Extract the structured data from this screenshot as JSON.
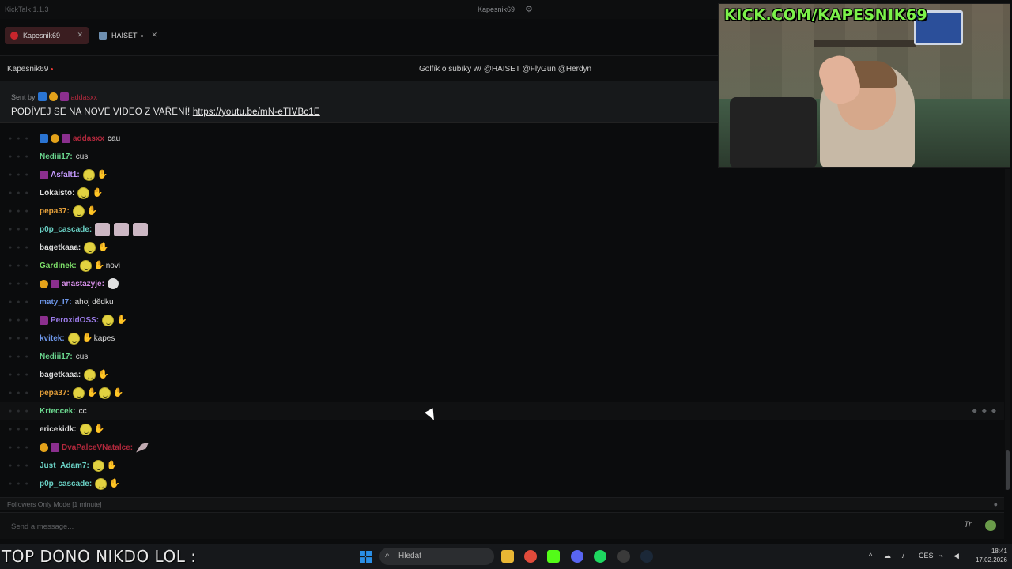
{
  "app": {
    "title": "KickTalk 1.1.3",
    "current_user": "Kapesnik69",
    "settings_icon": "gear-icon"
  },
  "tabs": [
    {
      "label": "Kapesnik69",
      "active": true
    },
    {
      "label": "HAISET",
      "active": false
    }
  ],
  "channel": {
    "name": "Kapesnik69",
    "stream_title": "Golfík o subíky w/ @HAISET @FlyGun @Herdyn"
  },
  "pinned": {
    "sent_by_label": "Sent by",
    "sent_by_user": "addasxx",
    "message": "PODÍVEJ SE NA NOVÉ VIDEO Z VAŘENÍ!",
    "link": "https://youtu.be/mN-eTIVBc1E"
  },
  "messages": [
    {
      "user": "addasxx",
      "color": "#b1283c",
      "text": "cau",
      "emotes": []
    },
    {
      "user": "Nediii17:",
      "color": "#6bd88f",
      "text": "cus",
      "emotes": []
    },
    {
      "user": "Asfalt1:",
      "color": "#c69bff",
      "text": "",
      "emotes": [
        "smile",
        "wave"
      ]
    },
    {
      "user": "Lokaisto:",
      "color": "#dedede",
      "text": "",
      "emotes": [
        "smile",
        "wave"
      ]
    },
    {
      "user": "pepa37:",
      "color": "#e5a03a",
      "text": "",
      "emotes": [
        "smile",
        "wave"
      ]
    },
    {
      "user": "p0p_cascade:",
      "color": "#6ad1c5",
      "text": "",
      "emotes": [
        "cat",
        "cat",
        "cat"
      ]
    },
    {
      "user": "bagetkaaa:",
      "color": "#dedede",
      "text": "",
      "emotes": [
        "smile",
        "wave"
      ]
    },
    {
      "user": "Gardinek:",
      "color": "#7ee06a",
      "text": "novi",
      "emotes": [
        "smile",
        "wave"
      ]
    },
    {
      "user": "anastazyje:",
      "color": "#d68fe8",
      "text": "",
      "emotes": [
        "skull"
      ]
    },
    {
      "user": "maty_I7:",
      "color": "#6d96e8",
      "text": "ahoj dědku",
      "emotes": []
    },
    {
      "user": "PeroxidOSS:",
      "color": "#9b7be8",
      "text": "",
      "emotes": [
        "smile",
        "wave"
      ]
    },
    {
      "user": "kvitek:",
      "color": "#6d96e8",
      "text": "kapes",
      "emotes": [
        "smile",
        "wave"
      ]
    },
    {
      "user": "Nediii17:",
      "color": "#6bd88f",
      "text": "cus",
      "emotes": []
    },
    {
      "user": "bagetkaaa:",
      "color": "#dedede",
      "text": "",
      "emotes": [
        "smile",
        "wave"
      ]
    },
    {
      "user": "pepa37:",
      "color": "#e5a03a",
      "text": "",
      "emotes": [
        "smile",
        "wave",
        "smile",
        "wave"
      ]
    },
    {
      "user": "Krteccek:",
      "color": "#6bd88f",
      "text": "cc",
      "emotes": []
    },
    {
      "user": "ericekidk:",
      "color": "#dedede",
      "text": "",
      "emotes": [
        "smile",
        "wave"
      ]
    },
    {
      "user": "DvaPalceVNatalce:",
      "color": "#b1283c",
      "text": "",
      "emotes": [
        "wing"
      ]
    },
    {
      "user": "Just_Adam7:",
      "color": "#6ad1c5",
      "text": "",
      "emotes": [
        "smile",
        "wave"
      ]
    },
    {
      "user": "p0p_cascade:",
      "color": "#6ad1c5",
      "text": "",
      "emotes": [
        "smile",
        "wave"
      ]
    }
  ],
  "followers_mode": "Followers Only Mode [1 minute]",
  "input": {
    "placeholder": "Send a message..."
  },
  "stream_overlay": {
    "url_banner": "KICK.COM/KAPESNIK69",
    "ticker": "TOP DONO NIKDO LOL :"
  },
  "taskbar": {
    "search_placeholder": "Hledat",
    "language": "CES",
    "time": "18:41",
    "date": "17.02.2026"
  }
}
